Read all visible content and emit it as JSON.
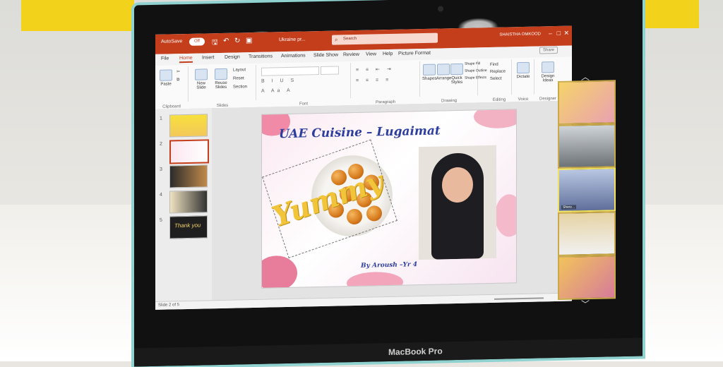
{
  "titlebar": {
    "autosave_label": "AutoSave",
    "autosave_state": "Off",
    "doc_title": "Ukraine pr...",
    "search_placeholder": "Search",
    "user_name": "SHAISTHA OMKOOD",
    "icons": [
      "save-icon",
      "undo-icon",
      "redo-icon",
      "present-icon"
    ]
  },
  "tabs": [
    "File",
    "Home",
    "Insert",
    "Design",
    "Transitions",
    "Animations",
    "Slide Show",
    "Review",
    "View",
    "Help",
    "Picture Format"
  ],
  "active_tab": "Home",
  "share_label": "Share",
  "ribbon": {
    "groups": {
      "clipboard": "Clipboard",
      "slides": "Slides",
      "font": "Font",
      "paragraph": "Paragraph",
      "drawing": "Drawing",
      "editing": "Editing",
      "voice": "Voice",
      "designer": "Designer"
    },
    "paste": "Paste",
    "new_slide": "New Slide",
    "reuse_slides": "Reuse Slides",
    "layout": "Layout",
    "reset": "Reset",
    "section": "Section",
    "shapes": "Shapes",
    "arrange": "Arrange",
    "quick_styles": "Quick Styles",
    "shape_fill": "Shape Fill",
    "shape_outline": "Shape Outline",
    "shape_effects": "Shape Effects",
    "find": "Find",
    "replace": "Replace",
    "select": "Select",
    "dictate": "Dictate",
    "design_ideas": "Design Ideas"
  },
  "thumbnails": {
    "numbers": [
      "1",
      "2",
      "3",
      "4",
      "5"
    ],
    "slide5_text": "Thank you",
    "selected_index": 1
  },
  "slide": {
    "title": "UAE Cuisine – Lugaimat",
    "word_art": "Yummy",
    "byline": "By Aroush –Yr 4"
  },
  "status": {
    "slide_counter": "Slide 2 of 5"
  },
  "brand": "MacBook Pro",
  "participants": {
    "names": [
      "",
      "",
      "Sherz...",
      "",
      ""
    ],
    "nav_up": "︿",
    "nav_down": "﹀"
  },
  "colors": {
    "accent": "#c43e1c",
    "title_blue": "#2d3e9c",
    "yummy_gold": "#f1c43a"
  }
}
